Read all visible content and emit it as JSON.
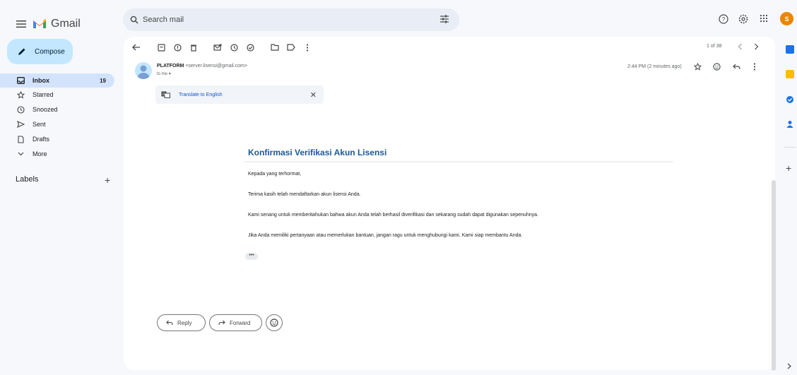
{
  "app": {
    "name": "Gmail"
  },
  "search": {
    "placeholder": "Search mail"
  },
  "compose": {
    "label": "Compose"
  },
  "sidebar": {
    "items": [
      {
        "label": "Inbox",
        "count": "19"
      },
      {
        "label": "Starred"
      },
      {
        "label": "Snoozed"
      },
      {
        "label": "Sent"
      },
      {
        "label": "Drafts"
      },
      {
        "label": "More"
      }
    ],
    "labels_heading": "Labels"
  },
  "toolbar": {
    "page_info": "1 of 38"
  },
  "message": {
    "sender_name": "PLATFORM",
    "sender_email": "<server.lisensi@gmail.com>",
    "recipient": "to me",
    "time": "2:44 PM (2 minutes ago)",
    "translate_label": "Translate to English",
    "title": "Konfirmasi Verifikasi Akun Lisensi",
    "paragraphs": [
      "Kepada yang terhormat,",
      "Terima kasih telah mendaftarkan akun lisensi Anda.",
      "Kami senang untuk memberitahukan bahwa akun Anda telah berhasil diverifikasi dan sekarang sudah dapat digunakan sepenuhnya.",
      "Jika Anda memiliki pertanyaan atau memerlukan bantuan, jangan ragu untuk menghubungi kami. Kami siap membantu Anda."
    ],
    "more_label": "•••"
  },
  "actions": {
    "reply": "Reply",
    "forward": "Forward"
  },
  "profile": {
    "initial": "S"
  },
  "colors": {
    "compose_bg": "#c2e7ff",
    "inbox_active": "#d3e3fd",
    "title": "#1a5a96",
    "avatar": "#ea8600"
  }
}
